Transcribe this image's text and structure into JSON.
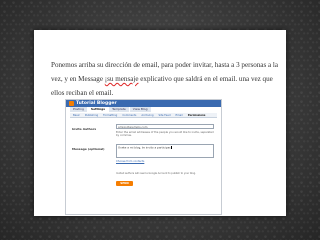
{
  "slide": {
    "text_before": "Ponemos arriba su dirección de email, para poder invitar, hasta a 3 personas a la vez, y en Message ",
    "text_underlined": "¡su mensaje",
    "text_after": " explicativo que saldrá en el email. una vez que ellos reciban el email."
  },
  "screenshot": {
    "app_title": "Tutorial Blogger",
    "tabs": [
      "Posting",
      "Settings",
      "Template",
      "View Blog"
    ],
    "active_tab_index": 1,
    "subtabs": [
      "Basic",
      "Publishing",
      "Formatting",
      "Comments",
      "Archiving",
      "Site Feed",
      "Email",
      "Permissions"
    ],
    "active_subtab_index": 7,
    "form": {
      "invite_label": "Invite Authors",
      "email_value": "amigo@ejemplo.com",
      "email_hint": "Enter the email addresses of the people you would like to invite, separated by commas.",
      "message_label": "Message (optional)",
      "message_value": "Únete a mi blog, te invito a participar.",
      "choose_contacts_link": "Choose from contacts",
      "footnote": "Invited authors will need a Google Account to publish to your blog.",
      "send_button": "SEND"
    }
  }
}
